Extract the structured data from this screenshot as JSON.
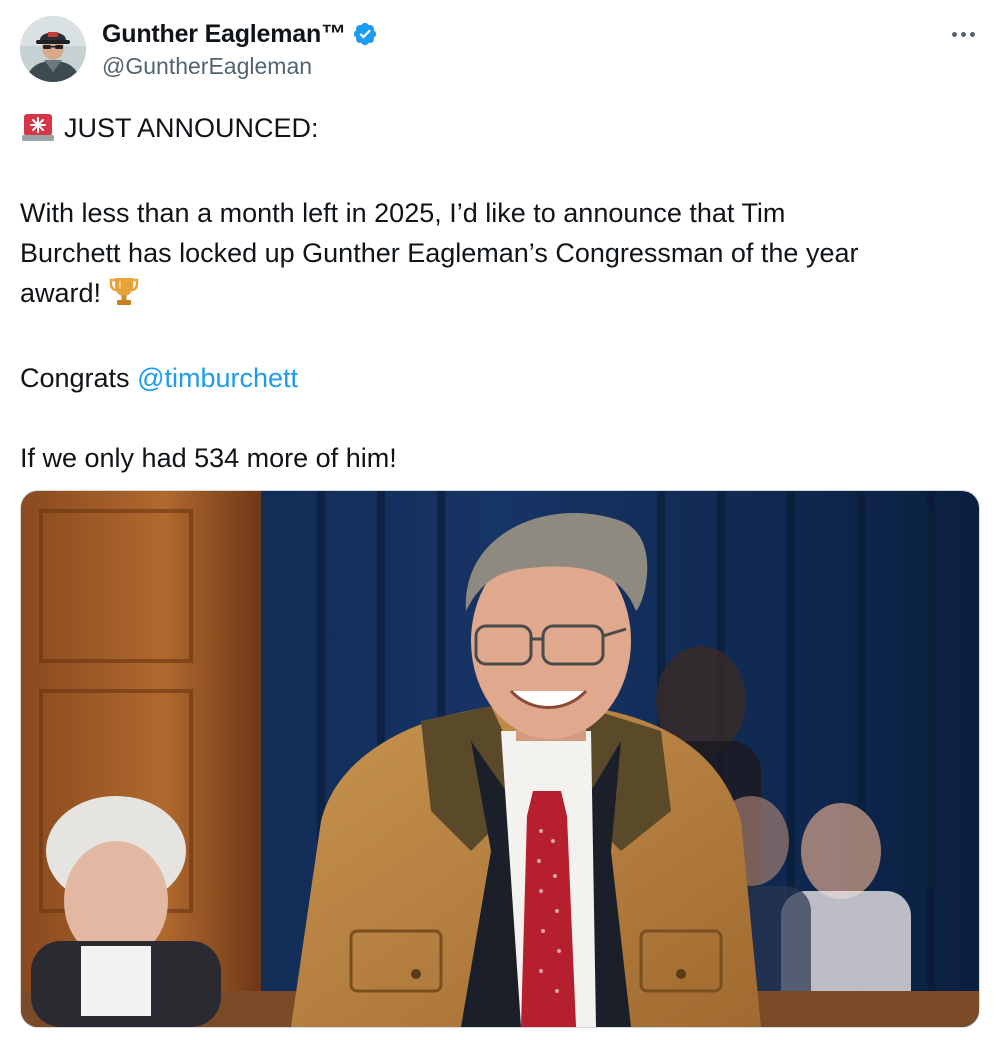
{
  "tweet": {
    "author": {
      "display_name": "Gunther Eagleman™",
      "handle": "@GuntherEagleman",
      "verified": true,
      "avatar_icon": "user-avatar"
    },
    "more_icon": "more-options-icon",
    "text": {
      "line1_emoji": "🚨",
      "line1": "JUST ANNOUNCED:",
      "para1_line1": "With less than a month left in 2025, I’d like to announce that Tim",
      "para1_line2": "Burchett has locked up Gunther Eagleman’s Congressman of the year",
      "para1_line3": "award!",
      "trophy_emoji": "🏆",
      "congrats": "Congrats",
      "mention": "@timburchett",
      "closing": "If we only had 534 more of him!"
    },
    "media": {
      "type": "photo",
      "icon": "photo-of-congressman"
    }
  },
  "colors": {
    "text": "#0f1419",
    "secondary": "#536471",
    "link": "#1d9bf0",
    "verified": "#1d9bf0",
    "border": "#cfd9de"
  }
}
